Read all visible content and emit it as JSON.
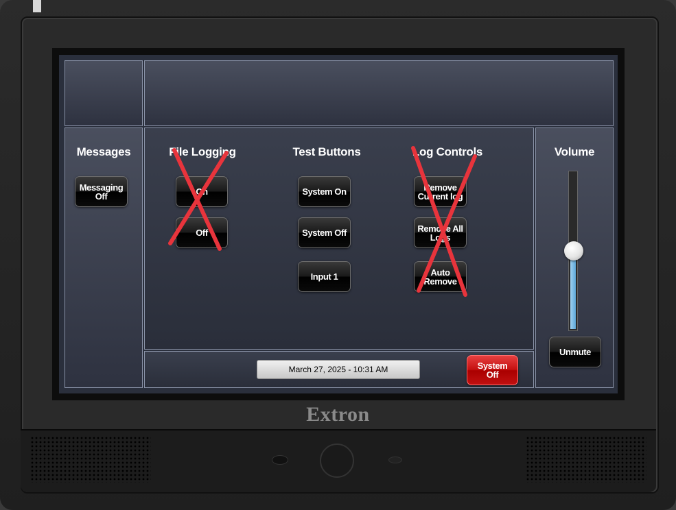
{
  "device": {
    "brand": "Extron"
  },
  "panels": {
    "messages": {
      "heading": "Messages",
      "messaging_button": "Messaging\nOff"
    },
    "file_logging": {
      "heading": "File Logging",
      "on_button": "On",
      "off_button": "Off",
      "crossed_out": true
    },
    "test_buttons": {
      "heading": "Test Buttons",
      "system_on_button": "System On",
      "system_off_button": "System Off",
      "input1_button": "Input 1"
    },
    "log_controls": {
      "heading": "Log Controls",
      "remove_current_button": "Remove\nCurrent log",
      "remove_all_button": "Remove All\nLogs",
      "auto_remove_button": "Auto\nRemove",
      "crossed_out": true
    },
    "volume": {
      "heading": "Volume",
      "level_fraction": 0.5,
      "unmute_button": "Unmute"
    }
  },
  "footer": {
    "datetime": "March 27, 2025  -  10:31 AM",
    "system_off_button": "System\nOff"
  },
  "colors": {
    "cross": "#e8343c",
    "system_off_red": "#c41010",
    "volume_fill": "#7cbce6"
  }
}
